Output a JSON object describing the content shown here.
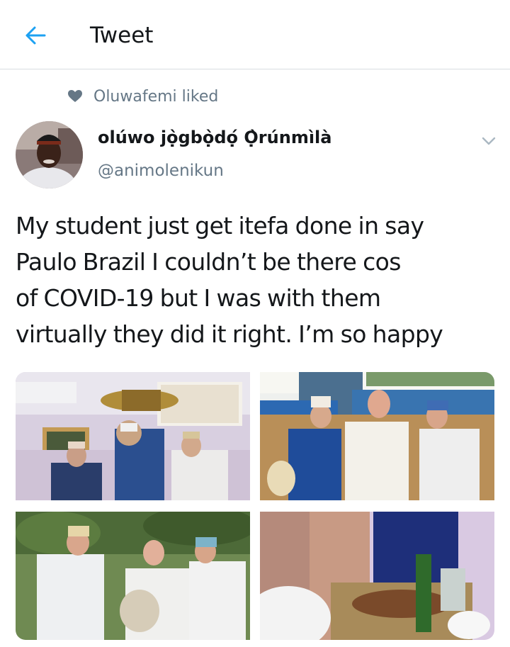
{
  "header": {
    "title": "Tweet",
    "back_icon": "arrow-left-icon",
    "accent_color": "#1da1f2"
  },
  "social_context": {
    "icon": "heart-icon",
    "text": "Oluwafemi liked"
  },
  "tweet": {
    "author_name": "olúwo jọ̀gbọ̀dọ́ Ọ̀rúnmìlà",
    "author_handle": "@animolenikun",
    "text_lines": [
      "My student just get itefa done in say",
      "Paulo Brazil I couldn’t be there cos",
      "of COVID-19 but I was with them",
      "virtually they did it right. I’m so happy"
    ],
    "photo_count": 4
  },
  "colors": {
    "text_primary": "#14171a",
    "text_secondary": "#657786",
    "divider": "#d9dde0"
  }
}
